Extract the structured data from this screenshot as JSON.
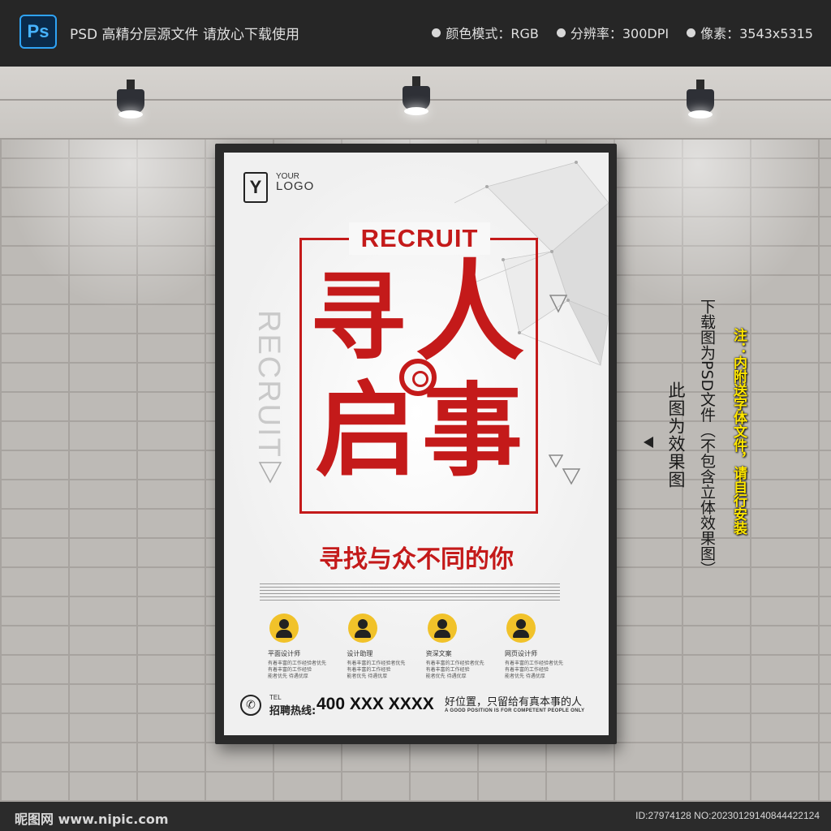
{
  "topbar": {
    "app_badge": "Ps",
    "title": "PSD 高精分层源文件 请放心下载使用",
    "specs": [
      "颜色模式：RGB",
      "分辨率：300DPI",
      "像素：3543x5315"
    ]
  },
  "poster": {
    "logo": {
      "mark": "Y",
      "line1": "YOUR",
      "line2": "LOGO",
      "subtext": ""
    },
    "recruit_title": "RECRUIT",
    "vertical_recruit": "RECRUIT",
    "chars": [
      "寻",
      "人",
      "启",
      "事"
    ],
    "slogan": "寻找与众不同的你",
    "jobs": [
      {
        "title": "平面设计师",
        "desc": "有着丰富的工作经验者优先\n有着丰富的工作经验\n能者优先 待遇优厚"
      },
      {
        "title": "设计助理",
        "desc": "有着丰富的工作经验者优先\n有着丰富的工作经验\n能者优先 待遇优厚"
      },
      {
        "title": "资深文案",
        "desc": "有着丰富的工作经验者优先\n有着丰富的工作经验\n能者优先 待遇优厚"
      },
      {
        "title": "网页设计师",
        "desc": "有着丰富的工作经验者优先\n有着丰富的工作经验\n能者优先 待遇优厚"
      }
    ],
    "tel": {
      "en": "TEL",
      "label": "招聘热线:",
      "number": "400 XXX XXXX"
    },
    "good_position": "好位置，只留给有真本事的人",
    "good_position_en": "A GOOD POSITION IS FOR COMPETENT PEOPLE ONLY"
  },
  "side_notes": {
    "effect": "此图为效果图",
    "download": "下载图为PSD文件（不包含立体效果图）",
    "note": "注：内附送字体文件，请自行安装"
  },
  "watermark": {
    "site": "昵图网 www.nipic.com",
    "id": "ID:27974128 NO:20230129140844422124"
  },
  "colors": {
    "accent_red": "#c41a1a",
    "avatar_yellow": "#f1c22a",
    "note_yellow": "#ffe600"
  }
}
